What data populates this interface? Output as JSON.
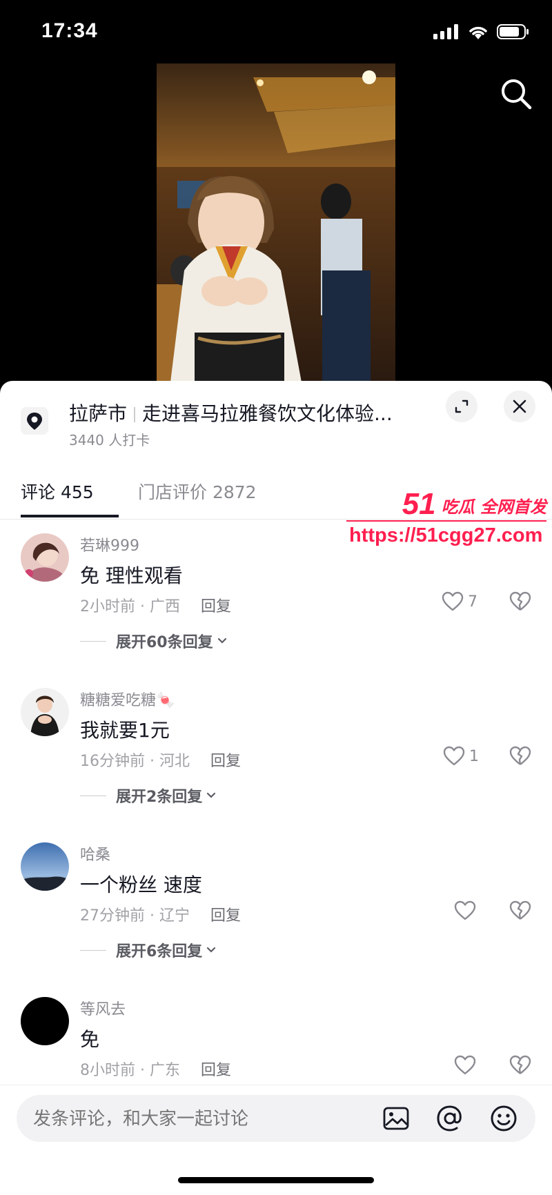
{
  "status": {
    "time": "17:34"
  },
  "location": {
    "city": "拉萨市",
    "name": "走进喜马拉雅餐饮文化体验...",
    "checkins": "3440 人打卡"
  },
  "tabs": [
    {
      "label": "评论 455"
    },
    {
      "label": "门店评价 2872"
    }
  ],
  "comments": [
    {
      "user": "若琳999",
      "text": "免 理性观看",
      "meta": "2小时前 · 广西",
      "reply": "回复",
      "likes": "7",
      "expand": "展开60条回复"
    },
    {
      "user": "糖糖爱吃糖🍬",
      "text": "我就要1元",
      "meta": "16分钟前 · 河北",
      "reply": "回复",
      "likes": "1",
      "expand": "展开2条回复"
    },
    {
      "user": "哈桑",
      "text": "一个粉丝 速度",
      "meta": "27分钟前 · 辽宁",
      "reply": "回复",
      "likes": "",
      "expand": "展开6条回复"
    },
    {
      "user": "等风去",
      "text": "免",
      "meta": "8小时前 · 广东",
      "reply": "回复",
      "likes": "",
      "expand": ""
    }
  ],
  "watermark": {
    "brand": "51",
    "slogan": "吃瓜 全网首发",
    "url": "https://51cgg27.com"
  },
  "input": {
    "placeholder": "发条评论，和大家一起讨论"
  },
  "colors": {
    "text": "#161823",
    "muted": "#8a8b91",
    "watermark": "#ff1f4f"
  }
}
